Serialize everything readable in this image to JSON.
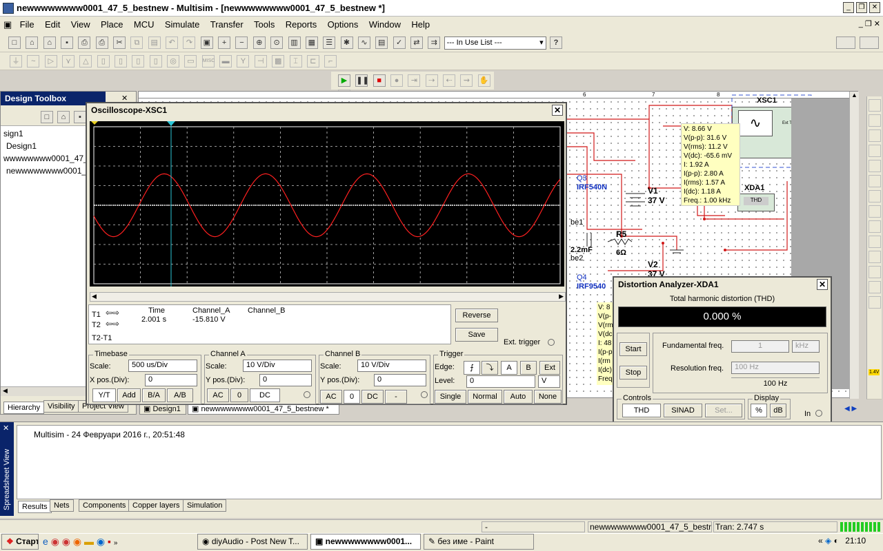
{
  "app": {
    "title": "newwwwwwww0001_47_5_bestnew - Multisim - [newwwwwwww0001_47_5_bestnew *]"
  },
  "menu": [
    "File",
    "Edit",
    "View",
    "Place",
    "MCU",
    "Simulate",
    "Transfer",
    "Tools",
    "Reports",
    "Options",
    "Window",
    "Help"
  ],
  "toolbar": {
    "in_use_list": "--- In Use List ---",
    "help": "?",
    "misc": "MISC"
  },
  "toolbox": {
    "title": "Design Toolbox",
    "items": [
      "sign1",
      "Design1",
      "wwwwwwww0001_47_",
      "newwwwwwww0001_"
    ],
    "tabs": [
      "Hierarchy",
      "Visibility",
      "Project View"
    ]
  },
  "osc": {
    "title": "Oscilloscope-XSC1",
    "t1": "T1",
    "t2": "T2",
    "t2t1": "T2-T1",
    "col_time": "Time",
    "col_a": "Channel_A",
    "col_b": "Channel_B",
    "time_val": "2.001 s",
    "a_val": "-15.810 V",
    "reverse": "Reverse",
    "save": "Save",
    "ext_trigger": "Ext. trigger",
    "timebase": {
      "title": "Timebase",
      "scale_lbl": "Scale:",
      "scale": "500 us/Div",
      "xpos_lbl": "X pos.(Div):",
      "xpos": "0",
      "buttons": [
        "Y/T",
        "Add",
        "B/A",
        "A/B"
      ]
    },
    "cha": {
      "title": "Channel A",
      "scale_lbl": "Scale:",
      "scale": "10  V/Div",
      "ypos_lbl": "Y pos.(Div):",
      "ypos": "0",
      "buttons": [
        "AC",
        "0",
        "DC"
      ]
    },
    "chb": {
      "title": "Channel B",
      "scale_lbl": "Scale:",
      "scale": "10  V/Div",
      "ypos_lbl": "Y pos.(Div):",
      "ypos": "0",
      "buttons": [
        "AC",
        "0",
        "DC",
        "-"
      ]
    },
    "trigger": {
      "title": "Trigger",
      "edge_lbl": "Edge:",
      "level_lbl": "Level:",
      "level": "0",
      "unit": "V",
      "edge_btns": [
        "A",
        "B",
        "Ext"
      ],
      "modes": [
        "Single",
        "Normal",
        "Auto",
        "None"
      ]
    }
  },
  "probe": {
    "lines": [
      "V: 8.66 V",
      "V(p-p): 31.6 V",
      "V(rms): 11.2 V",
      "V(dc): -65.6 mV",
      "I: 1.92 A",
      "I(p-p): 2.80 A",
      "I(rms): 1.57 A",
      "I(dc): 1.18 A",
      "Freq.: 1.00 kHz"
    ]
  },
  "probe2": {
    "lines": [
      "V: 8",
      "V(p-",
      "V(rm",
      "V(dc",
      "I: 48",
      "I(p-p",
      "I(rm",
      "I(dc)",
      "Freq"
    ]
  },
  "schematic": {
    "q3": "Q3",
    "q3part": "IRF540N",
    "q4": "Q4",
    "q4part": "IRF9540",
    "v1": "V1",
    "v1val": "37 V",
    "v2": "V2",
    "v2val": "37 V",
    "r5": "R5",
    "r5val": "6Ω",
    "cap": "2.2mF",
    "be1": "be1",
    "be2": "be2",
    "xsc1": "XSC1",
    "xda1": "XDA1",
    "thd": "THD",
    "ruler": [
      "6",
      "7",
      "8"
    ],
    "badge": "1.4V"
  },
  "thd": {
    "title": "Distortion Analyzer-XDA1",
    "subtitle": "Total harmonic distortion (THD)",
    "display": "0.000 %",
    "start": "Start",
    "stop": "Stop",
    "fund_lbl": "Fundamental freq.",
    "fund_val": "1",
    "fund_unit": "kHz",
    "res_lbl": "Resolution freq.",
    "res_val": "100 Hz",
    "res_display": "100 Hz",
    "controls": "Controls",
    "ctrl_btns": [
      "THD",
      "SINAD",
      "Set..."
    ],
    "display_lbl": "Display",
    "disp_btns": [
      "%",
      "dB"
    ],
    "in": "In"
  },
  "doc_tabs": [
    "Design1",
    "newwwwwwww0001_47_5_bestnew *"
  ],
  "spreadsheet": {
    "side": "Spreadsheet View",
    "log": "Multisim  -  24 Февруари 2016 г., 20:51:48",
    "tabs": [
      "Results",
      "Nets",
      "Components",
      "Copper layers",
      "Simulation"
    ]
  },
  "status": {
    "dash": "-",
    "file": "newwwwwwww0001_47_5_bestne",
    "tran": "Tran: 2.747 s"
  },
  "taskbar": {
    "start": "Старт",
    "items": [
      "diyAudio - Post New T...",
      "newwwwwwww0001...",
      "без име - Paint"
    ],
    "clock": "21:10"
  },
  "chart_data": {
    "type": "line",
    "title": "",
    "xlabel": "",
    "ylabel": "",
    "x_divisions": 10,
    "y_divisions": 8,
    "series": [
      {
        "name": "",
        "color": "#ff2020",
        "amplitude_div": 1.6,
        "cycles": 4.6,
        "phase_deg": 200
      }
    ]
  }
}
